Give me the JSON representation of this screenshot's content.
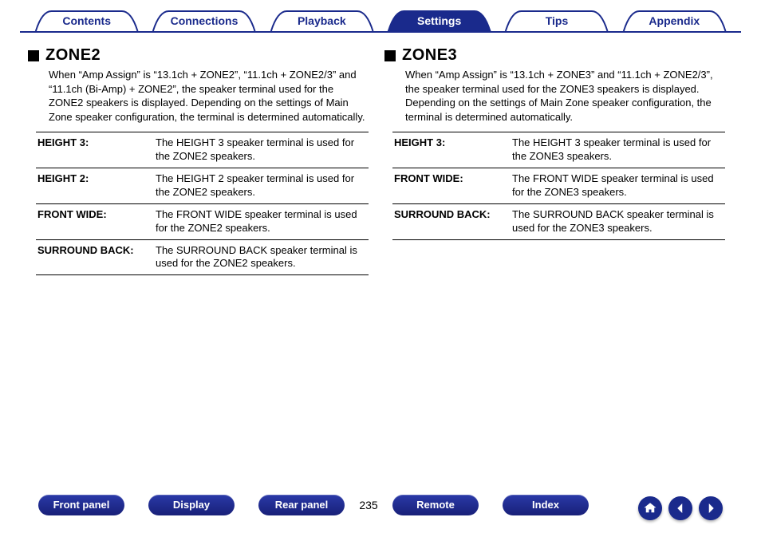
{
  "tabs": [
    {
      "label": "Contents",
      "active": false
    },
    {
      "label": "Connections",
      "active": false
    },
    {
      "label": "Playback",
      "active": false
    },
    {
      "label": "Settings",
      "active": true
    },
    {
      "label": "Tips",
      "active": false
    },
    {
      "label": "Appendix",
      "active": false
    }
  ],
  "zone2": {
    "title": "ZONE2",
    "intro": "When “Amp Assign” is “13.1ch + ZONE2”, “11.1ch + ZONE2/3” and “11.1ch (Bi-Amp) + ZONE2”, the speaker terminal used for the ZONE2 speakers is displayed. Depending on the settings of Main Zone speaker configuration, the terminal is determined automatically.",
    "rows": [
      {
        "k": "HEIGHT 3:",
        "v": "The HEIGHT 3 speaker terminal is used for the ZONE2 speakers."
      },
      {
        "k": "HEIGHT 2:",
        "v": "The HEIGHT 2 speaker terminal is used for the ZONE2 speakers."
      },
      {
        "k": "FRONT WIDE:",
        "v": "The FRONT WIDE speaker terminal is used for the ZONE2 speakers."
      },
      {
        "k": "SURROUND BACK:",
        "v": "The SURROUND BACK speaker terminal is used for the ZONE2 speakers."
      }
    ]
  },
  "zone3": {
    "title": "ZONE3",
    "intro": "When “Amp Assign” is “13.1ch + ZONE3” and “11.1ch + ZONE2/3”, the speaker terminal used for the ZONE3 speakers is displayed. Depending on the settings of Main Zone speaker configuration, the terminal is determined automatically.",
    "rows": [
      {
        "k": "HEIGHT 3:",
        "v": "The HEIGHT 3 speaker terminal is used for the ZONE3 speakers."
      },
      {
        "k": "FRONT WIDE:",
        "v": "The FRONT WIDE speaker terminal is used for the ZONE3 speakers."
      },
      {
        "k": "SURROUND BACK:",
        "v": "The SURROUND BACK speaker terminal is used for the ZONE3 speakers."
      }
    ]
  },
  "bottom": {
    "buttons": [
      "Front panel",
      "Display",
      "Rear panel",
      "Remote",
      "Index"
    ],
    "page": "235"
  }
}
